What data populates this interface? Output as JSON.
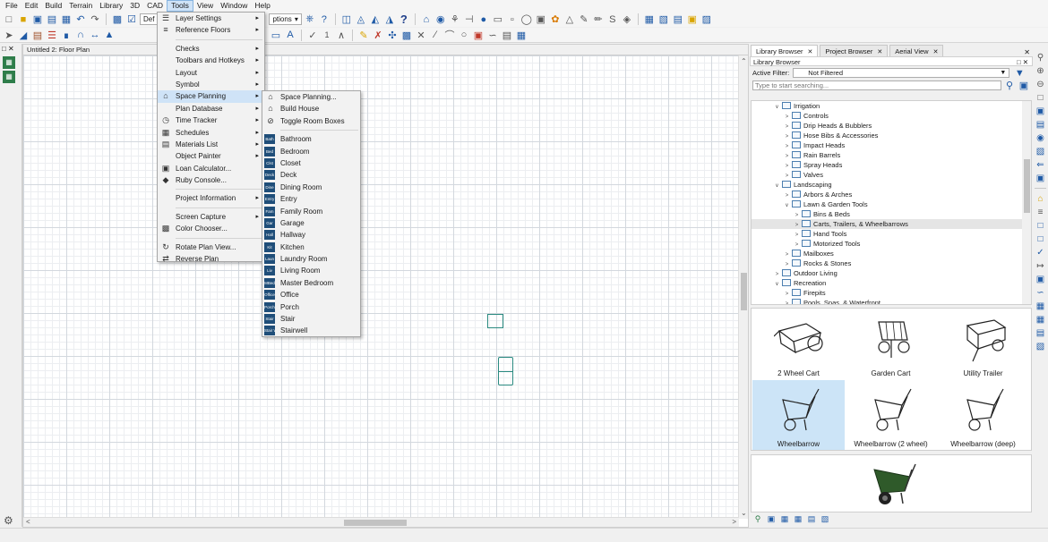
{
  "menubar": {
    "items": [
      "File",
      "Edit",
      "Build",
      "Terrain",
      "Library",
      "3D",
      "CAD",
      "Tools",
      "View",
      "Window",
      "Help"
    ],
    "active": "Tools"
  },
  "toolbar": {
    "default_combo": "Def",
    "options_combo": "ptions",
    "number_field": "1"
  },
  "document": {
    "tab_title": "Untitled 2: Floor Plan"
  },
  "tools_menu": {
    "items": [
      {
        "label": "Layer Settings",
        "icon": "layer-icon",
        "submenu": true
      },
      {
        "label": "Reference Floors",
        "icon": "reference-floors-icon",
        "submenu": true
      },
      {
        "sep": true
      },
      {
        "label": "Checks",
        "submenu": true
      },
      {
        "label": "Toolbars and Hotkeys",
        "submenu": true
      },
      {
        "label": "Layout",
        "submenu": true
      },
      {
        "label": "Symbol",
        "submenu": true
      },
      {
        "label": "Space Planning",
        "icon": "space-planning-icon",
        "submenu": true,
        "highlighted": true
      },
      {
        "label": "Plan Database",
        "submenu": true
      },
      {
        "label": "Time Tracker",
        "icon": "clock-icon",
        "submenu": true
      },
      {
        "label": "Schedules",
        "icon": "schedule-icon",
        "submenu": true
      },
      {
        "label": "Materials List",
        "icon": "materials-list-icon",
        "submenu": true
      },
      {
        "label": "Object Painter",
        "submenu": true
      },
      {
        "label": "Loan Calculator...",
        "icon": "calculator-icon"
      },
      {
        "label": "Ruby Console...",
        "icon": "ruby-icon"
      },
      {
        "sep": true
      },
      {
        "label": "Project Information",
        "submenu": true
      },
      {
        "sep": true
      },
      {
        "label": "Screen Capture",
        "submenu": true
      },
      {
        "label": "Color Chooser...",
        "icon": "color-chooser-icon"
      },
      {
        "sep": true
      },
      {
        "label": "Rotate Plan View...",
        "icon": "rotate-plan-icon"
      },
      {
        "label": "Reverse Plan",
        "icon": "reverse-plan-icon"
      }
    ]
  },
  "space_planning_menu": {
    "items": [
      {
        "label": "Space Planning...",
        "icon": "space-planning-icon"
      },
      {
        "label": "Build House",
        "icon": "house-icon"
      },
      {
        "label": "Toggle Room Boxes",
        "icon": "toggle-icon"
      },
      {
        "sep": true
      },
      {
        "label": "Bathroom",
        "tag": "Bath"
      },
      {
        "label": "Bedroom",
        "tag": "Bed"
      },
      {
        "label": "Closet",
        "tag": "Clst"
      },
      {
        "label": "Deck",
        "tag": "Deck"
      },
      {
        "label": "Dining Room",
        "tag": "Dine"
      },
      {
        "label": "Entry",
        "tag": "Entry"
      },
      {
        "label": "Family Room",
        "tag": "Fam"
      },
      {
        "label": "Garage",
        "tag": "Gar"
      },
      {
        "label": "Hallway",
        "tag": "Hall"
      },
      {
        "label": "Kitchen",
        "tag": "Kit"
      },
      {
        "label": "Laundry Room",
        "tag": "Laun"
      },
      {
        "label": "Living Room",
        "tag": "Liv"
      },
      {
        "label": "Master Bedroom",
        "tag": "MBed"
      },
      {
        "label": "Office",
        "tag": "Office"
      },
      {
        "label": "Porch",
        "tag": "Porch"
      },
      {
        "label": "Stair",
        "tag": "Stair"
      },
      {
        "label": "Stairwell",
        "tag": "Stair Well"
      }
    ]
  },
  "right_panel": {
    "tabs": [
      {
        "label": "Library Browser",
        "active": true
      },
      {
        "label": "Project Browser",
        "active": false
      },
      {
        "label": "Aerial View",
        "active": false
      }
    ],
    "header": "Library Browser",
    "active_filter_label": "Active Filter:",
    "active_filter_value": "Not Filtered",
    "search_placeholder": "Type to start searching...",
    "tree": [
      {
        "label": "Irrigation",
        "depth": 3,
        "expanded": true
      },
      {
        "label": "Controls",
        "depth": 4
      },
      {
        "label": "Drip Heads & Bubblers",
        "depth": 4
      },
      {
        "label": "Hose Bibs & Accessories",
        "depth": 4
      },
      {
        "label": "Impact Heads",
        "depth": 4
      },
      {
        "label": "Rain Barrels",
        "depth": 4
      },
      {
        "label": "Spray Heads",
        "depth": 4
      },
      {
        "label": "Valves",
        "depth": 4
      },
      {
        "label": "Landscaping",
        "depth": 3,
        "expanded": true
      },
      {
        "label": "Arbors & Arches",
        "depth": 4
      },
      {
        "label": "Lawn & Garden Tools",
        "depth": 4,
        "expanded": true
      },
      {
        "label": "Bins & Beds",
        "depth": 5
      },
      {
        "label": "Carts, Trailers, & Wheelbarrows",
        "depth": 5,
        "selected": true
      },
      {
        "label": "Hand Tools",
        "depth": 5
      },
      {
        "label": "Motorized Tools",
        "depth": 5
      },
      {
        "label": "Mailboxes",
        "depth": 4
      },
      {
        "label": "Rocks & Stones",
        "depth": 4
      },
      {
        "label": "Outdoor Living",
        "depth": 3
      },
      {
        "label": "Recreation",
        "depth": 3,
        "expanded": true
      },
      {
        "label": "Firepits",
        "depth": 4
      },
      {
        "label": "Pools, Spas, & Waterfront",
        "depth": 4
      }
    ],
    "items": [
      {
        "label": "2 Wheel Cart",
        "icon": "cart-icon"
      },
      {
        "label": "Garden Cart",
        "icon": "garden-cart-icon"
      },
      {
        "label": "Utility Trailer",
        "icon": "trailer-icon"
      },
      {
        "label": "Wheelbarrow",
        "icon": "wheelbarrow-icon",
        "selected": true
      },
      {
        "label": "Wheelbarrow (2 wheel)",
        "icon": "wheelbarrow-icon"
      },
      {
        "label": "Wheelbarrow (deep)",
        "icon": "wheelbarrow-icon"
      }
    ]
  },
  "colors": {
    "menu_highlight": "#cfe3f7",
    "selection": "#cce4f7",
    "room_tag": "#1f4e79",
    "plan_object": "#2a8a80"
  }
}
